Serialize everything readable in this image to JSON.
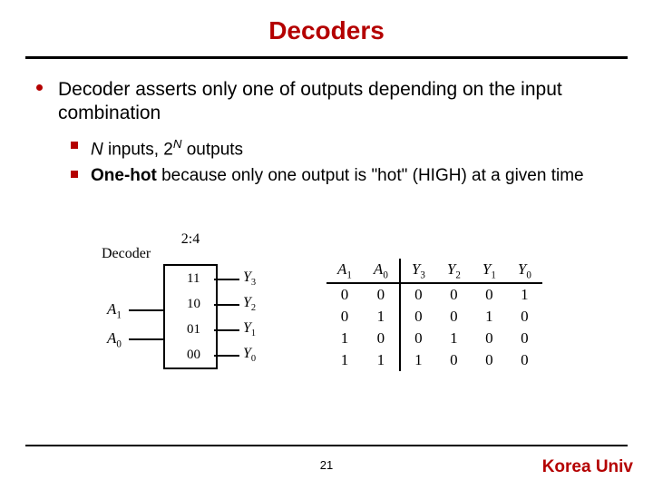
{
  "title": "Decoders",
  "bullet_main": "Decoder asserts only one of outputs depending on the input combination",
  "sub": {
    "a_pre": "N",
    "a_mid": " inputs, 2",
    "a_sup": "N",
    "a_post": " outputs",
    "b_bold": "One-hot",
    "b_rest": " because only one output is \"hot\" (HIGH) at a given time"
  },
  "decoder": {
    "ratio": "2:4",
    "name": "Decoder",
    "in1": "A",
    "in1_sub": "1",
    "in0": "A",
    "in0_sub": "0",
    "rows": [
      "11",
      "10",
      "01",
      "00"
    ],
    "outs": [
      "3",
      "2",
      "1",
      "0"
    ],
    "out_sym": "Y"
  },
  "truth": {
    "headers": [
      "A",
      "1",
      "A",
      "0",
      "Y",
      "3",
      "Y",
      "2",
      "Y",
      "1",
      "Y",
      "0"
    ],
    "rows": [
      [
        "0",
        "0",
        "0",
        "0",
        "0",
        "1"
      ],
      [
        "0",
        "1",
        "0",
        "0",
        "1",
        "0"
      ],
      [
        "1",
        "0",
        "0",
        "1",
        "0",
        "0"
      ],
      [
        "1",
        "1",
        "1",
        "0",
        "0",
        "0"
      ]
    ]
  },
  "page": "21",
  "footer": "Korea Univ"
}
